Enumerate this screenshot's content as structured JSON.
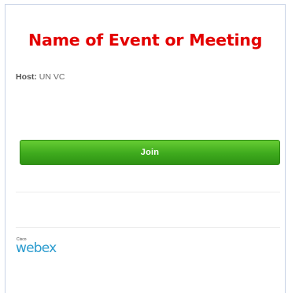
{
  "meeting": {
    "title": "Name of Event or Meeting",
    "host_label": "Host:",
    "host_name": "UN VC"
  },
  "actions": {
    "join_label": "Join"
  },
  "branding": {
    "small_text": "Cisco",
    "logo_text": "webex",
    "logo_icon": "cisco-webex-logo"
  },
  "colors": {
    "title": "#e30000",
    "join_button": "#3eaa1d",
    "logo": "#2c9ccf"
  }
}
